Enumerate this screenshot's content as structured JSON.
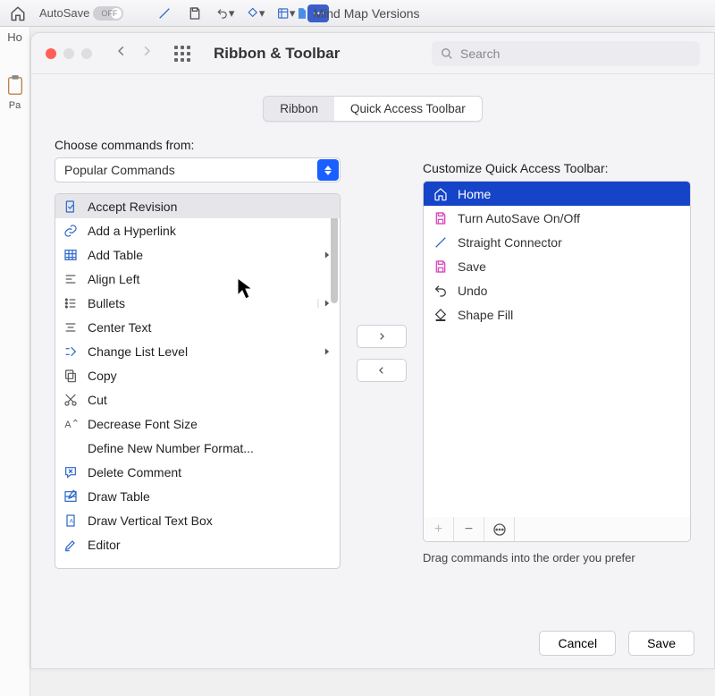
{
  "app": {
    "autosave_label": "AutoSave",
    "autosave_state": "OFF",
    "doc_title": "Mind Map Versions",
    "home_label": "Ho",
    "paste_label": "Pa"
  },
  "modal": {
    "title": "Ribbon & Toolbar",
    "search_placeholder": "Search",
    "tabs": {
      "ribbon": "Ribbon",
      "qat": "Quick Access Toolbar"
    },
    "choose_label": "Choose commands from:",
    "choose_value": "Popular Commands",
    "customize_label": "Customize Quick Access Toolbar:",
    "hint": "Drag commands into the order you prefer",
    "commands": [
      {
        "label": "Accept Revision",
        "icon": "doc-check",
        "selected": true
      },
      {
        "label": "Add a Hyperlink",
        "icon": "link"
      },
      {
        "label": "Add Table",
        "icon": "table",
        "submenu": true
      },
      {
        "label": "Align Left",
        "icon": "align-left"
      },
      {
        "label": "Bullets",
        "icon": "bullets",
        "submenu": true,
        "split": true
      },
      {
        "label": "Center Text",
        "icon": "align-center"
      },
      {
        "label": "Change List Level",
        "icon": "list-level",
        "submenu": true
      },
      {
        "label": "Copy",
        "icon": "copy"
      },
      {
        "label": "Cut",
        "icon": "cut"
      },
      {
        "label": "Decrease Font Size",
        "icon": "font-dec"
      },
      {
        "label": "Define New Number Format...",
        "icon": ""
      },
      {
        "label": "Delete Comment",
        "icon": "comment-x"
      },
      {
        "label": "Draw Table",
        "icon": "draw-table"
      },
      {
        "label": "Draw Vertical Text Box",
        "icon": "textbox-v"
      },
      {
        "label": "Editor",
        "icon": "editor"
      }
    ],
    "qat_items": [
      {
        "label": "Home",
        "icon": "home",
        "selected": true
      },
      {
        "label": "Turn AutoSave On/Off",
        "icon": "save-pink"
      },
      {
        "label": "Straight Connector",
        "icon": "connector"
      },
      {
        "label": "Save",
        "icon": "save-pink"
      },
      {
        "label": "Undo",
        "icon": "undo",
        "split": true
      },
      {
        "label": "Shape Fill",
        "icon": "shape-fill",
        "split": true
      }
    ],
    "footer": {
      "cancel": "Cancel",
      "save": "Save"
    }
  }
}
